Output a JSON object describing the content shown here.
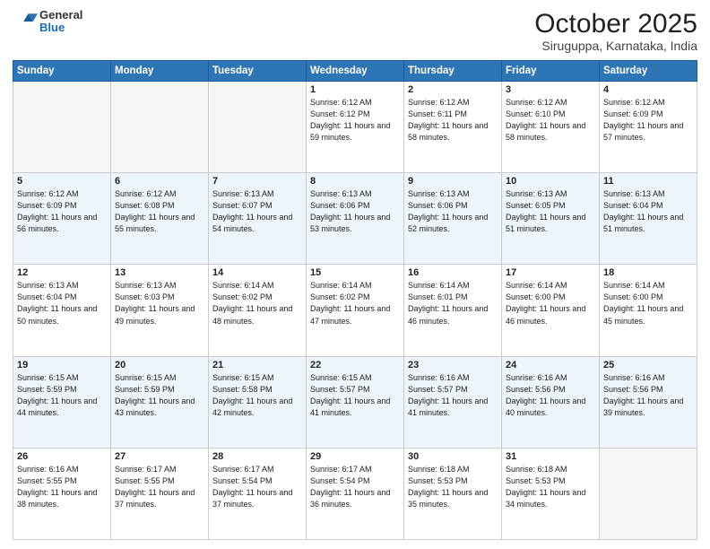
{
  "logo": {
    "general": "General",
    "blue": "Blue"
  },
  "header": {
    "month": "October 2025",
    "location": "Siruguppa, Karnataka, India"
  },
  "weekdays": [
    "Sunday",
    "Monday",
    "Tuesday",
    "Wednesday",
    "Thursday",
    "Friday",
    "Saturday"
  ],
  "weeks": [
    [
      {
        "day": "",
        "empty": true
      },
      {
        "day": "",
        "empty": true
      },
      {
        "day": "",
        "empty": true
      },
      {
        "day": "1",
        "sunrise": "6:12 AM",
        "sunset": "6:12 PM",
        "daylight": "11 hours and 59 minutes."
      },
      {
        "day": "2",
        "sunrise": "6:12 AM",
        "sunset": "6:11 PM",
        "daylight": "11 hours and 58 minutes."
      },
      {
        "day": "3",
        "sunrise": "6:12 AM",
        "sunset": "6:10 PM",
        "daylight": "11 hours and 58 minutes."
      },
      {
        "day": "4",
        "sunrise": "6:12 AM",
        "sunset": "6:09 PM",
        "daylight": "11 hours and 57 minutes."
      }
    ],
    [
      {
        "day": "5",
        "sunrise": "6:12 AM",
        "sunset": "6:09 PM",
        "daylight": "11 hours and 56 minutes."
      },
      {
        "day": "6",
        "sunrise": "6:12 AM",
        "sunset": "6:08 PM",
        "daylight": "11 hours and 55 minutes."
      },
      {
        "day": "7",
        "sunrise": "6:13 AM",
        "sunset": "6:07 PM",
        "daylight": "11 hours and 54 minutes."
      },
      {
        "day": "8",
        "sunrise": "6:13 AM",
        "sunset": "6:06 PM",
        "daylight": "11 hours and 53 minutes."
      },
      {
        "day": "9",
        "sunrise": "6:13 AM",
        "sunset": "6:06 PM",
        "daylight": "11 hours and 52 minutes."
      },
      {
        "day": "10",
        "sunrise": "6:13 AM",
        "sunset": "6:05 PM",
        "daylight": "11 hours and 51 minutes."
      },
      {
        "day": "11",
        "sunrise": "6:13 AM",
        "sunset": "6:04 PM",
        "daylight": "11 hours and 51 minutes."
      }
    ],
    [
      {
        "day": "12",
        "sunrise": "6:13 AM",
        "sunset": "6:04 PM",
        "daylight": "11 hours and 50 minutes."
      },
      {
        "day": "13",
        "sunrise": "6:13 AM",
        "sunset": "6:03 PM",
        "daylight": "11 hours and 49 minutes."
      },
      {
        "day": "14",
        "sunrise": "6:14 AM",
        "sunset": "6:02 PM",
        "daylight": "11 hours and 48 minutes."
      },
      {
        "day": "15",
        "sunrise": "6:14 AM",
        "sunset": "6:02 PM",
        "daylight": "11 hours and 47 minutes."
      },
      {
        "day": "16",
        "sunrise": "6:14 AM",
        "sunset": "6:01 PM",
        "daylight": "11 hours and 46 minutes."
      },
      {
        "day": "17",
        "sunrise": "6:14 AM",
        "sunset": "6:00 PM",
        "daylight": "11 hours and 46 minutes."
      },
      {
        "day": "18",
        "sunrise": "6:14 AM",
        "sunset": "6:00 PM",
        "daylight": "11 hours and 45 minutes."
      }
    ],
    [
      {
        "day": "19",
        "sunrise": "6:15 AM",
        "sunset": "5:59 PM",
        "daylight": "11 hours and 44 minutes."
      },
      {
        "day": "20",
        "sunrise": "6:15 AM",
        "sunset": "5:59 PM",
        "daylight": "11 hours and 43 minutes."
      },
      {
        "day": "21",
        "sunrise": "6:15 AM",
        "sunset": "5:58 PM",
        "daylight": "11 hours and 42 minutes."
      },
      {
        "day": "22",
        "sunrise": "6:15 AM",
        "sunset": "5:57 PM",
        "daylight": "11 hours and 41 minutes."
      },
      {
        "day": "23",
        "sunrise": "6:16 AM",
        "sunset": "5:57 PM",
        "daylight": "11 hours and 41 minutes."
      },
      {
        "day": "24",
        "sunrise": "6:16 AM",
        "sunset": "5:56 PM",
        "daylight": "11 hours and 40 minutes."
      },
      {
        "day": "25",
        "sunrise": "6:16 AM",
        "sunset": "5:56 PM",
        "daylight": "11 hours and 39 minutes."
      }
    ],
    [
      {
        "day": "26",
        "sunrise": "6:16 AM",
        "sunset": "5:55 PM",
        "daylight": "11 hours and 38 minutes."
      },
      {
        "day": "27",
        "sunrise": "6:17 AM",
        "sunset": "5:55 PM",
        "daylight": "11 hours and 37 minutes."
      },
      {
        "day": "28",
        "sunrise": "6:17 AM",
        "sunset": "5:54 PM",
        "daylight": "11 hours and 37 minutes."
      },
      {
        "day": "29",
        "sunrise": "6:17 AM",
        "sunset": "5:54 PM",
        "daylight": "11 hours and 36 minutes."
      },
      {
        "day": "30",
        "sunrise": "6:18 AM",
        "sunset": "5:53 PM",
        "daylight": "11 hours and 35 minutes."
      },
      {
        "day": "31",
        "sunrise": "6:18 AM",
        "sunset": "5:53 PM",
        "daylight": "11 hours and 34 minutes."
      },
      {
        "day": "",
        "empty": true
      }
    ]
  ]
}
